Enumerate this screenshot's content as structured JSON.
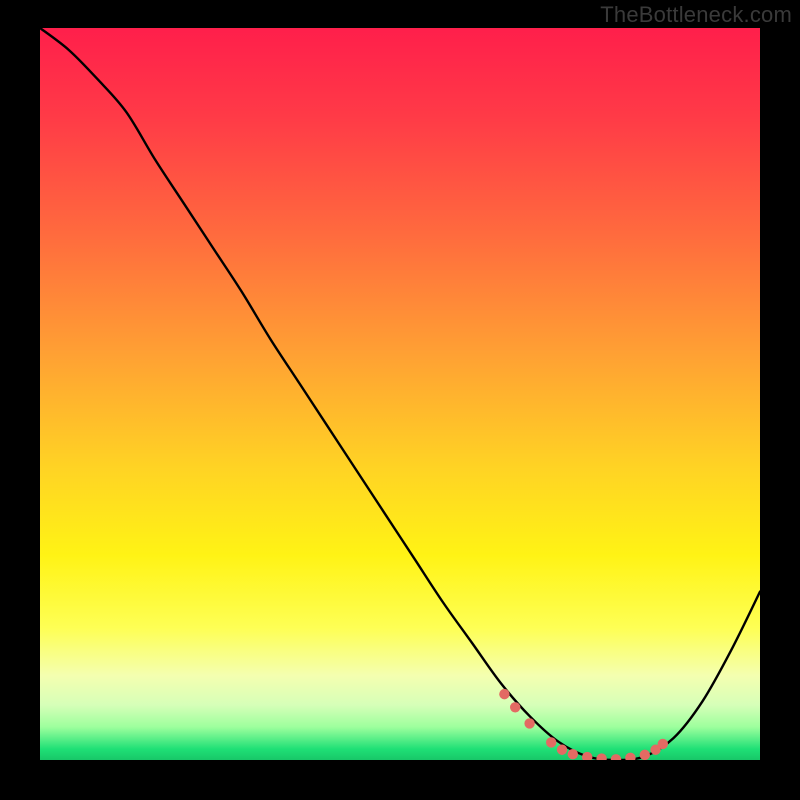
{
  "watermark": "TheBottleneck.com",
  "chart_data": {
    "type": "line",
    "title": "",
    "xlabel": "",
    "ylabel": "",
    "xlim": [
      0,
      100
    ],
    "ylim": [
      0,
      100
    ],
    "grid": false,
    "series": [
      {
        "name": "curve",
        "x": [
          0,
          4,
          8,
          12,
          16,
          20,
          24,
          28,
          32,
          36,
          40,
          44,
          48,
          52,
          56,
          60,
          64,
          68,
          72,
          76,
          80,
          84,
          88,
          92,
          96,
          100
        ],
        "y": [
          100,
          97,
          93,
          88.5,
          82,
          76,
          70,
          64,
          57.5,
          51.5,
          45.5,
          39.5,
          33.5,
          27.5,
          21.5,
          16,
          10.5,
          6,
          2.5,
          0.5,
          0,
          0.5,
          3,
          8,
          15,
          23
        ]
      }
    ],
    "markers": {
      "name": "highlight",
      "x": [
        64.5,
        66,
        68,
        71,
        72.5,
        74,
        76,
        78,
        80,
        82,
        84,
        85.5,
        86.5
      ],
      "y": [
        9,
        7.2,
        5,
        2.4,
        1.4,
        0.8,
        0.4,
        0.2,
        0.1,
        0.3,
        0.7,
        1.4,
        2.2
      ]
    },
    "gradient_stops": [
      {
        "offset": 0.0,
        "color": "#ff1f4b"
      },
      {
        "offset": 0.12,
        "color": "#ff3a47"
      },
      {
        "offset": 0.28,
        "color": "#ff6a3e"
      },
      {
        "offset": 0.45,
        "color": "#ffa233"
      },
      {
        "offset": 0.6,
        "color": "#ffd324"
      },
      {
        "offset": 0.72,
        "color": "#fff315"
      },
      {
        "offset": 0.82,
        "color": "#feff55"
      },
      {
        "offset": 0.885,
        "color": "#f4ffb0"
      },
      {
        "offset": 0.925,
        "color": "#d6ffb8"
      },
      {
        "offset": 0.955,
        "color": "#9dff9d"
      },
      {
        "offset": 0.985,
        "color": "#1fe076"
      },
      {
        "offset": 1.0,
        "color": "#18c768"
      }
    ]
  }
}
